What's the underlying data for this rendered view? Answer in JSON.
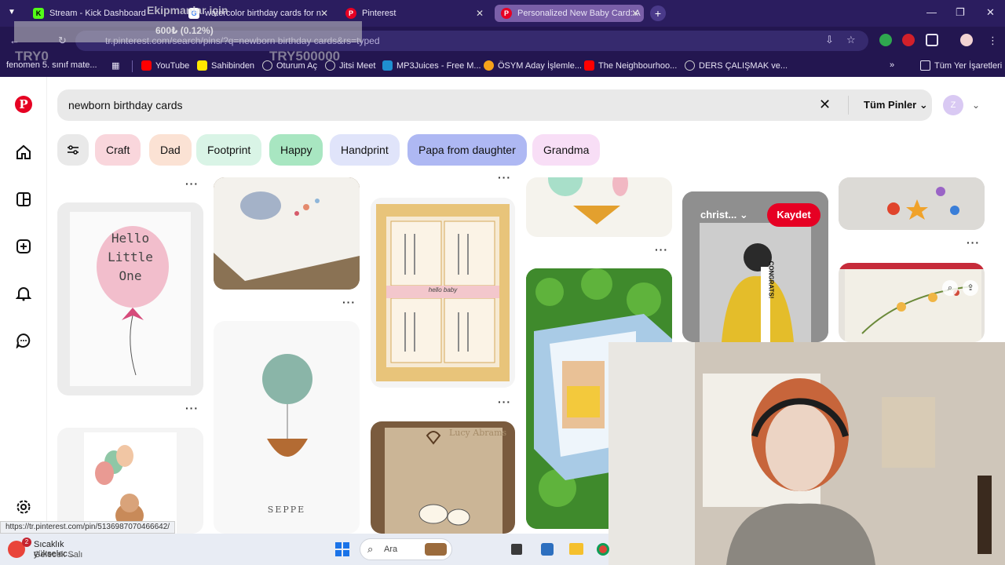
{
  "browser": {
    "tabs": [
      {
        "title": "Stream - Kick Dashboard",
        "favicon": "kick-icon",
        "color": "#53fc18"
      },
      {
        "title": "watercolor birthday cards for n",
        "favicon": "google-icon",
        "color": "#4285f4"
      },
      {
        "title": "Pinterest",
        "favicon": "pinterest-icon",
        "color": "#e60023"
      },
      {
        "title": "Personalized New Baby Card: A",
        "favicon": "pinterest-icon",
        "color": "#e60023"
      }
    ],
    "address": "tr.pinterest.com/search/pins/?q=newborn birthday cards&rs=typed",
    "bookmarks": [
      "fenomen 5. sınıf mate...",
      "YouTube",
      "Sahibinden",
      "Oturum Aç",
      "Jitsi Meet",
      "MP3Juices - Free M...",
      "ÖSYM Aday İşlemle...",
      "The Neighbourhoo...",
      "DERS ÇALIŞMAK ve..."
    ],
    "all_bookmarks": "Tüm Yer İşaretleri",
    "more_bookmarks": "»"
  },
  "overlay": {
    "goal_title": "Ekipmanlar için",
    "goal_amount": "600₺ (0.12%)",
    "left_value": "TRY0",
    "right_value": "TRY500000"
  },
  "pinterest": {
    "search_query": "newborn birthday cards",
    "filter_label": "Tüm Pinler",
    "chips": [
      {
        "label": "Craft",
        "color": "#f9d6dc"
      },
      {
        "label": "Dad",
        "color": "#fbe2d4"
      },
      {
        "label": "Footprint",
        "color": "#d9f4e6"
      },
      {
        "label": "Happy",
        "color": "#a8e6c1"
      },
      {
        "label": "Handprint",
        "color": "#e0e4fa"
      },
      {
        "label": "Papa from daughter",
        "color": "#aeb8f3"
      },
      {
        "label": "Grandma",
        "color": "#f8def6"
      }
    ],
    "pins": {
      "hello_card": [
        "Hello",
        "Little",
        "One"
      ],
      "hello_baby_tag": "hello baby",
      "seppe": "SEPPE",
      "lucy": "Lucy Abrams",
      "congrats": "CONGRATS!",
      "save_label": "Kaydet",
      "board_name": "christ..."
    },
    "accent": "#e60023"
  },
  "status_url": "https://tr.pinterest.com/pin/5136987070466642/",
  "taskbar": {
    "weather_title": "Sıcaklık yükselec...",
    "weather_sub": "Gelecek Salı",
    "weather_badge": "2",
    "search_placeholder": "Ara"
  }
}
